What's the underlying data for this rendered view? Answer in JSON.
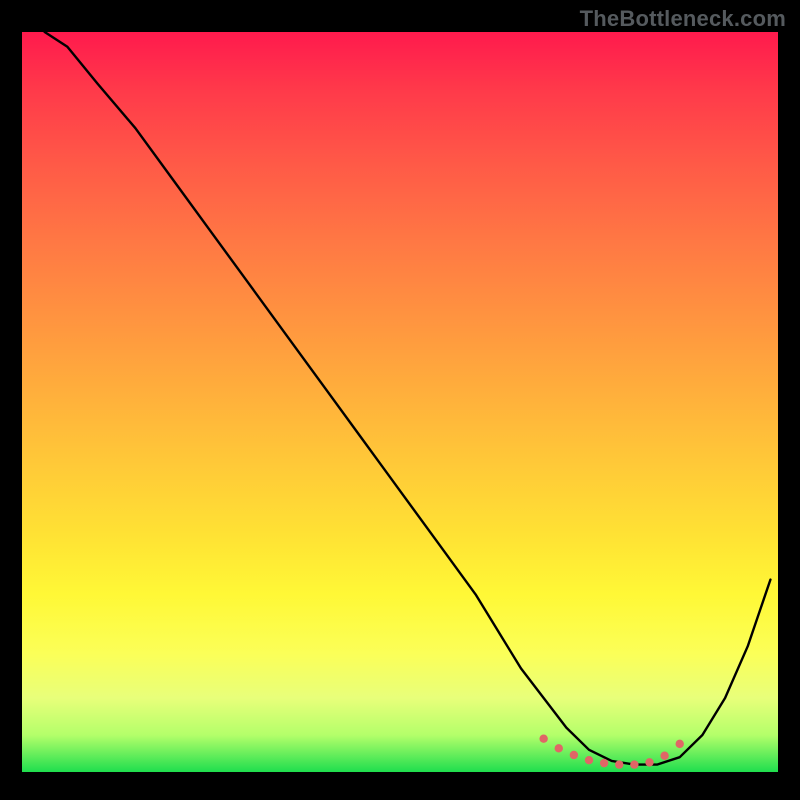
{
  "attribution": "TheBottleneck.com",
  "colors": {
    "frame": "#000000",
    "curve": "#000000",
    "markers": "#e06666",
    "gradient_top": "#ff1a4d",
    "gradient_bottom": "#1fde4e"
  },
  "chart_data": {
    "type": "line",
    "title": "",
    "xlabel": "",
    "ylabel": "",
    "xlim": [
      0,
      100
    ],
    "ylim": [
      0,
      100
    ],
    "grid": false,
    "legend": false,
    "series": [
      {
        "name": "bottleneck-curve",
        "x": [
          3,
          6,
          10,
          15,
          20,
          25,
          30,
          35,
          40,
          45,
          50,
          55,
          60,
          63,
          66,
          69,
          72,
          75,
          78,
          81,
          84,
          87,
          90,
          93,
          96,
          99
        ],
        "y": [
          100,
          98,
          93,
          87,
          80,
          73,
          66,
          59,
          52,
          45,
          38,
          31,
          24,
          19,
          14,
          10,
          6,
          3,
          1.5,
          1,
          1,
          2,
          5,
          10,
          17,
          26
        ]
      }
    ],
    "markers": {
      "name": "optimal-range",
      "x": [
        69,
        71,
        73,
        75,
        77,
        79,
        81,
        83,
        85,
        87
      ],
      "y": [
        4.5,
        3.2,
        2.3,
        1.6,
        1.2,
        1.0,
        1.0,
        1.3,
        2.2,
        3.8
      ]
    }
  }
}
